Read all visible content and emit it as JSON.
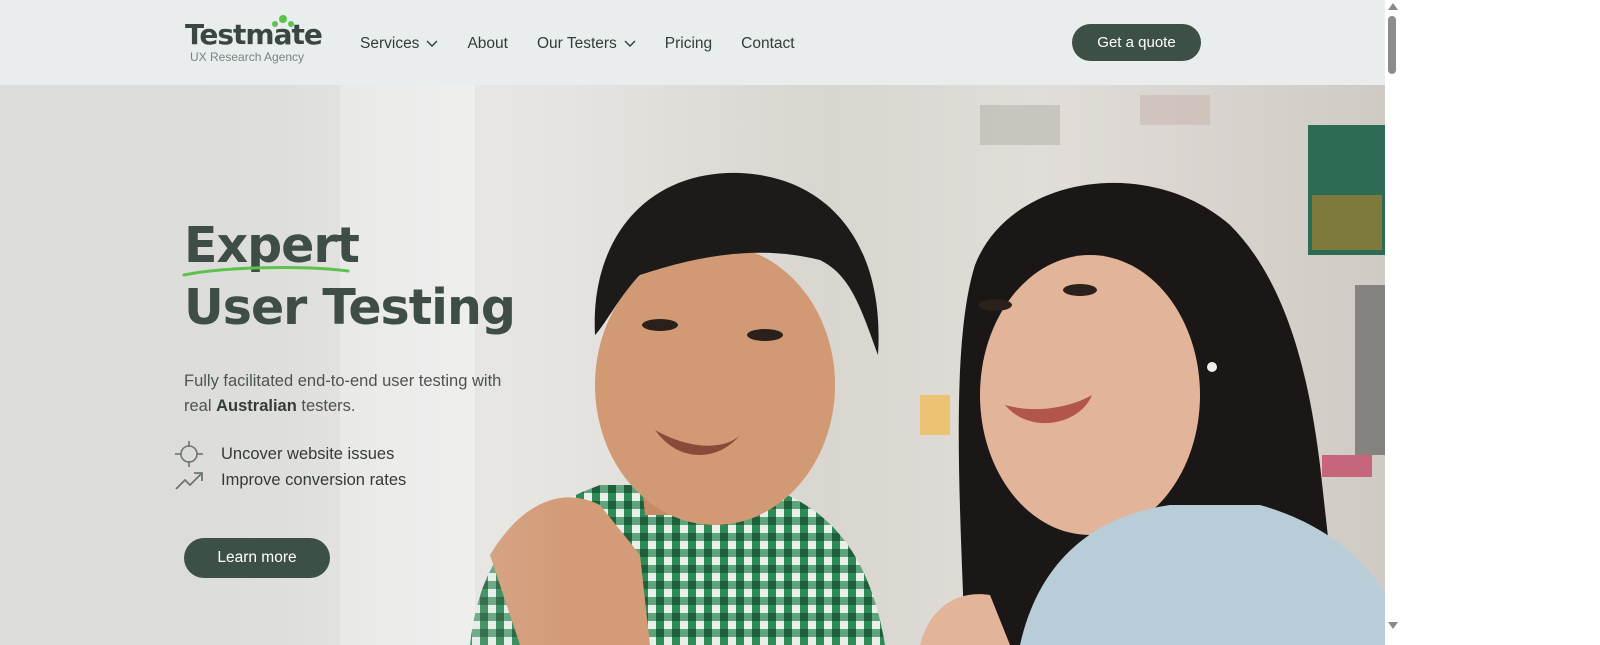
{
  "logo": {
    "word": "Testmate",
    "tagline": "UX Research Agency"
  },
  "nav": {
    "items": [
      {
        "label": "Services",
        "has_dropdown": true
      },
      {
        "label": "About",
        "has_dropdown": false
      },
      {
        "label": "Our Testers",
        "has_dropdown": true
      },
      {
        "label": "Pricing",
        "has_dropdown": false
      },
      {
        "label": "Contact",
        "has_dropdown": false
      }
    ],
    "cta_label": "Get a quote"
  },
  "hero": {
    "title_line1": "Expert",
    "title_line2": "User Testing",
    "desc_before": "Fully facilitated end-to-end user testing with real ",
    "desc_bold": "Australian",
    "desc_after": " testers.",
    "features": [
      {
        "icon": "target-icon",
        "text": "Uncover website issues"
      },
      {
        "icon": "trending-up-icon",
        "text": "Improve conversion rates"
      }
    ],
    "cta_label": "Learn more"
  },
  "colors": {
    "brand_dark": "#3d5046",
    "accent_green": "#5cc24b",
    "header_bg": "#e9edee"
  }
}
